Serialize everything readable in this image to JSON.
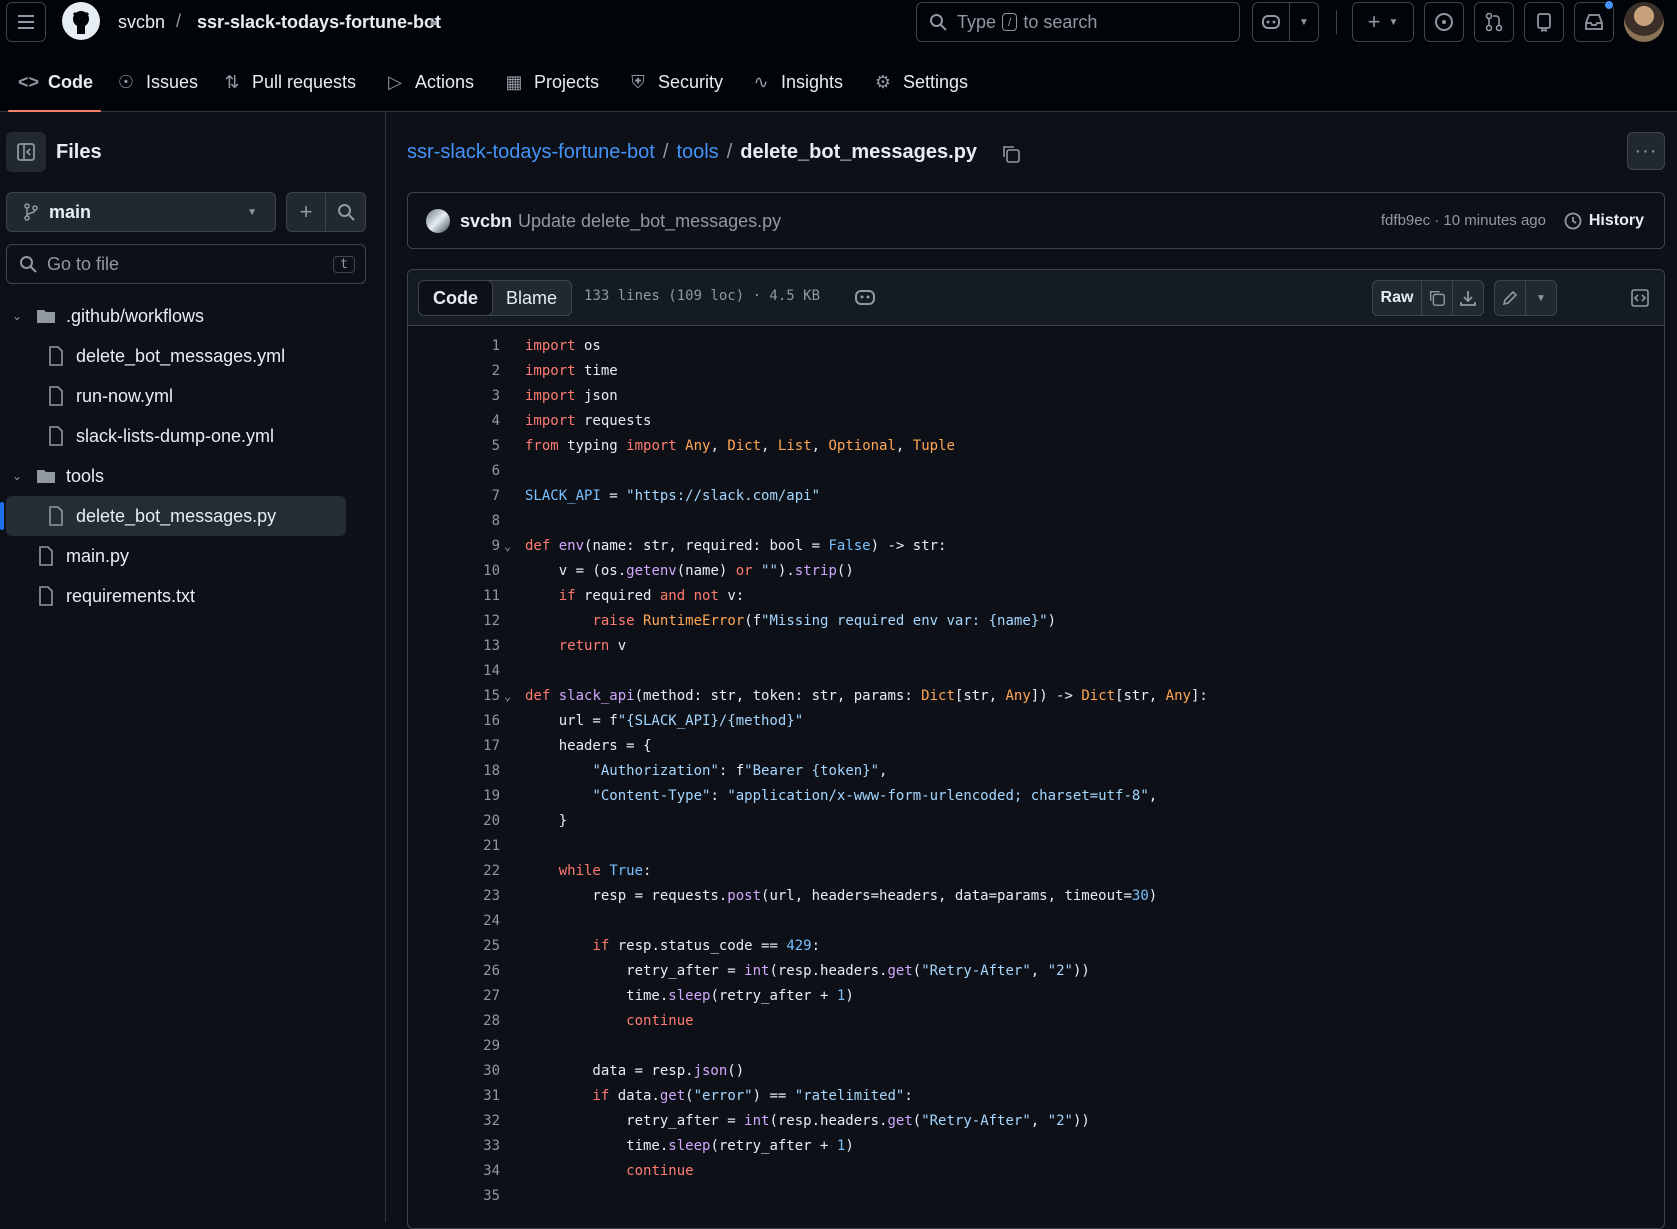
{
  "header": {
    "owner": "svcbn",
    "separator": "/",
    "repo": "ssr-slack-todays-fortune-bot",
    "search_prefix": "Type",
    "search_key": "/",
    "search_suffix": "to search"
  },
  "nav": {
    "tabs": [
      {
        "label": "Code",
        "icon": "code-icon"
      },
      {
        "label": "Issues",
        "icon": "issue-icon"
      },
      {
        "label": "Pull requests",
        "icon": "pull-request-icon"
      },
      {
        "label": "Actions",
        "icon": "play-icon"
      },
      {
        "label": "Projects",
        "icon": "table-icon"
      },
      {
        "label": "Security",
        "icon": "shield-icon"
      },
      {
        "label": "Insights",
        "icon": "graph-icon"
      },
      {
        "label": "Settings",
        "icon": "gear-icon"
      }
    ],
    "active": "Code"
  },
  "sidebar": {
    "title": "Files",
    "branch": "main",
    "goto_placeholder": "Go to file",
    "goto_key": "t",
    "tree": [
      {
        "label": ".github/workflows",
        "type": "folder"
      },
      {
        "label": "delete_bot_messages.yml",
        "type": "file"
      },
      {
        "label": "run-now.yml",
        "type": "file"
      },
      {
        "label": "slack-lists-dump-one.yml",
        "type": "file"
      },
      {
        "label": "tools",
        "type": "folder"
      },
      {
        "label": "delete_bot_messages.py",
        "type": "file",
        "selected": true
      },
      {
        "label": "main.py",
        "type": "file"
      },
      {
        "label": "requirements.txt",
        "type": "file"
      }
    ]
  },
  "breadcrumb": {
    "repo": "ssr-slack-todays-fortune-bot",
    "folder": "tools",
    "file": "delete_bot_messages.py",
    "sep": "/"
  },
  "commit": {
    "user": "svcbn",
    "message": "Update delete_bot_messages.py",
    "meta": "fdfb9ec · 10 minutes ago",
    "history_label": "History"
  },
  "file_header": {
    "code_tab": "Code",
    "blame_tab": "Blame",
    "info": "133 lines (109 loc) · 4.5 KB",
    "raw_label": "Raw"
  },
  "code_lines": [
    "import os",
    "import time",
    "import json",
    "import requests",
    "from typing import Any, Dict, List, Optional, Tuple",
    "",
    "SLACK_API = \"https://slack.com/api\"",
    "",
    "def env(name: str, required: bool = False) -> str:",
    "    v = (os.getenv(name) or \"\").strip()",
    "    if required and not v:",
    "        raise RuntimeError(f\"Missing required env var: {name}\")",
    "    return v",
    "",
    "def slack_api(method: str, token: str, params: Dict[str, Any]) -> Dict[str, Any]:",
    "    url = f\"{SLACK_API}/{method}\"",
    "    headers = {",
    "        \"Authorization\": f\"Bearer {token}\",",
    "        \"Content-Type\": \"application/x-www-form-urlencoded; charset=utf-8\",",
    "    }",
    "",
    "    while True:",
    "        resp = requests.post(url, headers=headers, data=params, timeout=30)",
    "",
    "        if resp.status_code == 429:",
    "            retry_after = int(resp.headers.get(\"Retry-After\", \"2\"))",
    "            time.sleep(retry_after + 1)",
    "            continue",
    "",
    "        data = resp.json()",
    "        if data.get(\"error\") == \"ratelimited\":",
    "            retry_after = int(resp.headers.get(\"Retry-After\", \"2\"))",
    "            time.sleep(retry_after + 1)",
    "            continue",
    ""
  ],
  "fold_lines": [
    9,
    15
  ],
  "colors": {
    "accent": "#4493f8",
    "tab_underline": "#f78166",
    "bg": "#0d1117"
  }
}
